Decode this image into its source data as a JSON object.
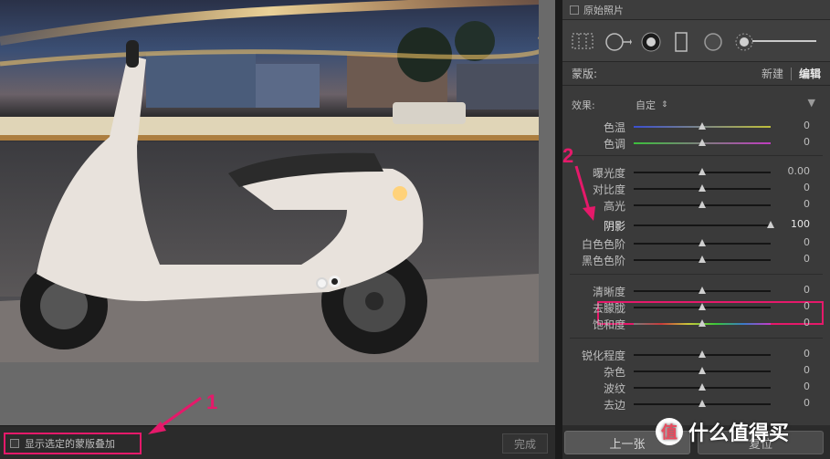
{
  "canvas": {
    "show_overlay_label": "显示选定的蒙版叠加",
    "done_label": "完成"
  },
  "annotations": {
    "one": "1",
    "two": "2"
  },
  "panel": {
    "original_label": "原始照片",
    "mask_label": "蒙版:",
    "mask_new": "新建",
    "mask_edit": "编辑",
    "effect_label": "效果:",
    "effect_value": "自定",
    "effect_caret": "⇕",
    "effect_triangle": "▼",
    "sliders": [
      {
        "label": "色温",
        "value": "0",
        "pos": 0.5,
        "track": "temp"
      },
      {
        "label": "色调",
        "value": "0",
        "pos": 0.5,
        "track": "tint"
      },
      {
        "label": "曝光度",
        "value": "0.00",
        "pos": 0.5,
        "track": "plain"
      },
      {
        "label": "对比度",
        "value": "0",
        "pos": 0.5,
        "track": "plain"
      },
      {
        "label": "高光",
        "value": "0",
        "pos": 0.5,
        "track": "plain"
      },
      {
        "label": "阴影",
        "value": "100",
        "pos": 1.0,
        "track": "plain"
      },
      {
        "label": "白色色阶",
        "value": "0",
        "pos": 0.5,
        "track": "plain"
      },
      {
        "label": "黑色色阶",
        "value": "0",
        "pos": 0.5,
        "track": "plain"
      },
      {
        "label": "清晰度",
        "value": "0",
        "pos": 0.5,
        "track": "plain"
      },
      {
        "label": "去朦胧",
        "value": "0",
        "pos": 0.5,
        "track": "plain"
      },
      {
        "label": "饱和度",
        "value": "0",
        "pos": 0.5,
        "track": "sat"
      },
      {
        "label": "锐化程度",
        "value": "0",
        "pos": 0.5,
        "track": "plain"
      },
      {
        "label": "杂色",
        "value": "0",
        "pos": 0.5,
        "track": "plain"
      },
      {
        "label": "波纹",
        "value": "0",
        "pos": 0.5,
        "track": "plain"
      },
      {
        "label": "去边",
        "value": "0",
        "pos": 0.5,
        "track": "plain"
      }
    ],
    "prev_label": "上一张",
    "reset_label": "复位"
  },
  "watermark": {
    "logo_glyph": "值",
    "text": "什么值得买"
  },
  "colors": {
    "accent": "#e5196a",
    "panel_bg": "#3a3a3a",
    "canvas_bg": "#6a6a6a"
  }
}
